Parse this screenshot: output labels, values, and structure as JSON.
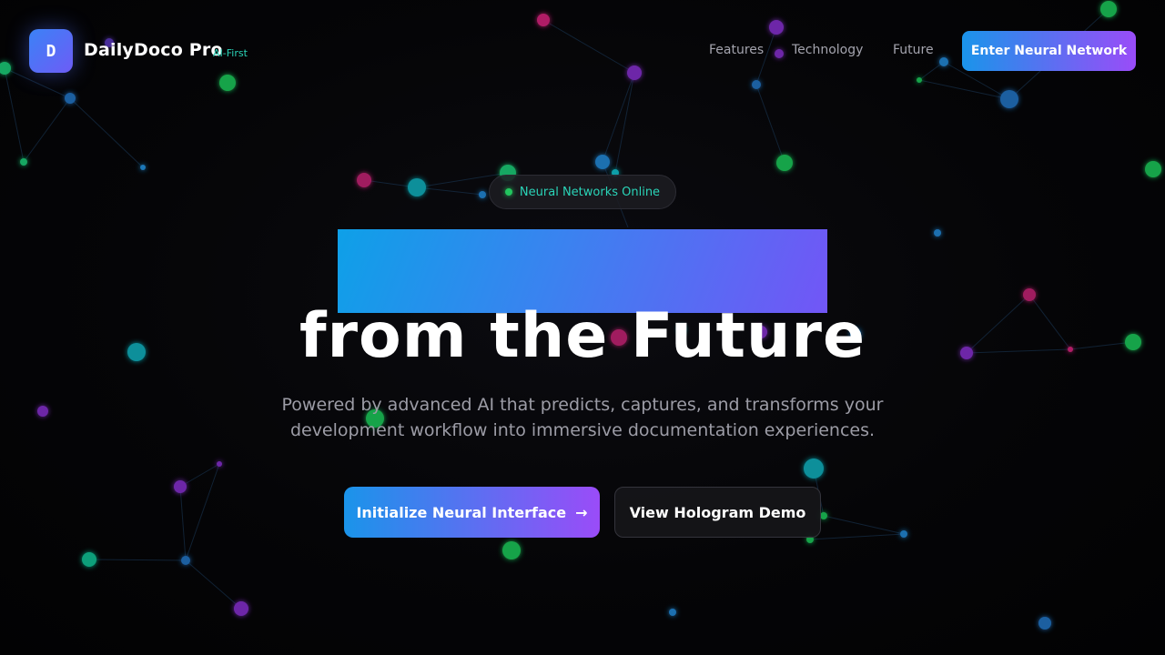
{
  "header": {
    "logo_letter": "D",
    "brand": "DailyDoco Pro",
    "tag": "AI-First",
    "nav": [
      "Features",
      "Technology",
      "Future"
    ],
    "cta": "Enter Neural Network"
  },
  "hero": {
    "badge": "Neural Networks Online",
    "title": "from the Future",
    "subtitle": "Powered by advanced AI that predicts, captures, and transforms your development workflow into immersive documentation experiences.",
    "primary_button": "Initialize Neural Interface",
    "primary_icon": "arrow-right-icon",
    "secondary_button": "View Hologram Demo"
  },
  "colors": {
    "accent_start": "#1a94ea",
    "accent_end": "#9a4cf8",
    "tag": "#2ad4b8",
    "status": "#22c55e"
  }
}
